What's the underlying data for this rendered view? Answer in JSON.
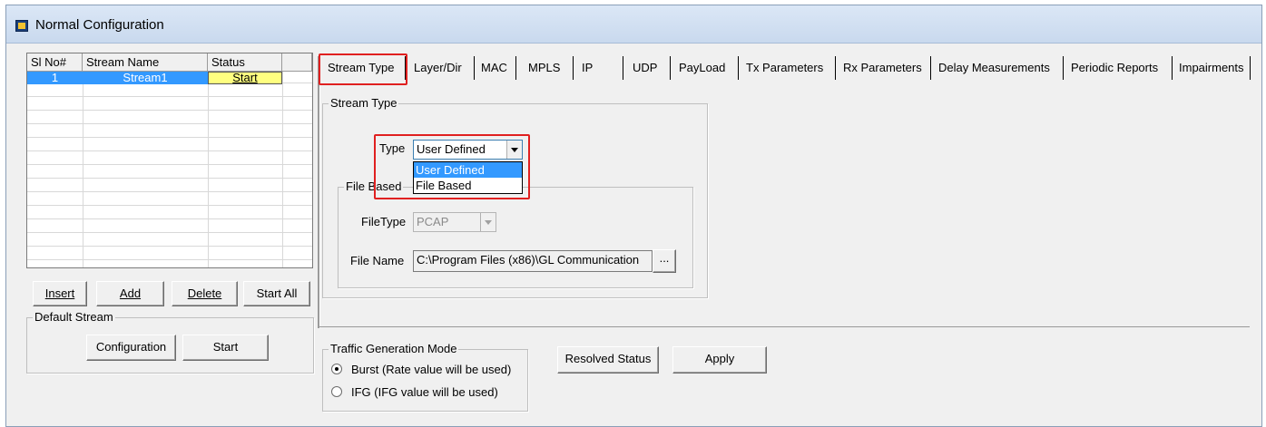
{
  "window": {
    "title": "Normal Configuration",
    "icon": "app-icon"
  },
  "stream_table": {
    "columns": [
      "Sl No#",
      "Stream Name",
      "Status"
    ],
    "rows": [
      {
        "sl_no": "1",
        "name": "Stream1",
        "status": "Start"
      }
    ],
    "selected_color": "#3399ff",
    "status_color": "#ffff80"
  },
  "stream_buttons": {
    "insert": "Insert",
    "add": "Add",
    "delete": "Delete",
    "start_all": "Start All"
  },
  "default_stream": {
    "legend": "Default Stream",
    "configuration": "Configuration",
    "start": "Start"
  },
  "tabs": [
    "Stream Type",
    "Layer/Dir",
    "MAC",
    "MPLS",
    "IP",
    "UDP",
    "PayLoad",
    "Tx Parameters",
    "Rx Parameters",
    "Delay Measurements",
    "Periodic Reports",
    "Impairments"
  ],
  "active_tab": "Stream Type",
  "stream_type": {
    "legend": "Stream Type",
    "type_label": "Type",
    "type_value": "User Defined",
    "type_options": [
      "User Defined",
      "File Based"
    ],
    "file_based": {
      "legend": "File Based",
      "filetype_label": "FileType",
      "filetype_value": "PCAP",
      "filename_label": "File Name",
      "filename_value": "C:\\Program Files (x86)\\GL Communication",
      "browse": "..."
    }
  },
  "traffic_mode": {
    "legend": "Traffic Generation Mode",
    "options": [
      "Burst (Rate value will be used)",
      "IFG (IFG value will be used)"
    ],
    "selected": "Burst (Rate value will be used)"
  },
  "actions": {
    "resolved_status": "Resolved Status",
    "apply": "Apply"
  },
  "colors": {
    "highlight": "#e02020",
    "selection": "#3399ff"
  }
}
